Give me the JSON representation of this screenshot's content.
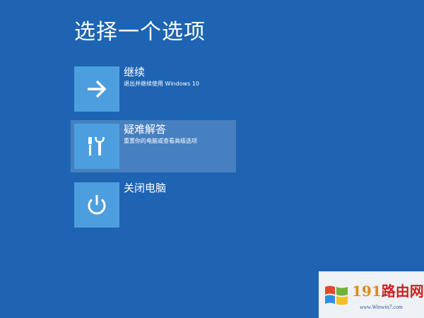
{
  "page": {
    "title": "选择一个选项"
  },
  "options": [
    {
      "title": "继续",
      "description": "退出并继续使用 Windows 10",
      "icon": "arrow-right-icon"
    },
    {
      "title": "疑难解答",
      "description": "重置你的电脑或查看高级选项",
      "icon": "tools-icon"
    },
    {
      "title": "关闭电脑",
      "description": "",
      "icon": "power-icon"
    }
  ],
  "watermark": {
    "brand_number": "191",
    "brand_text": "路由网",
    "url": "www.Winwin7.com"
  },
  "colors": {
    "background": "#1e64b3",
    "tile": "#4d9ede",
    "selected_highlight": "rgba(255,255,255,0.18)"
  }
}
